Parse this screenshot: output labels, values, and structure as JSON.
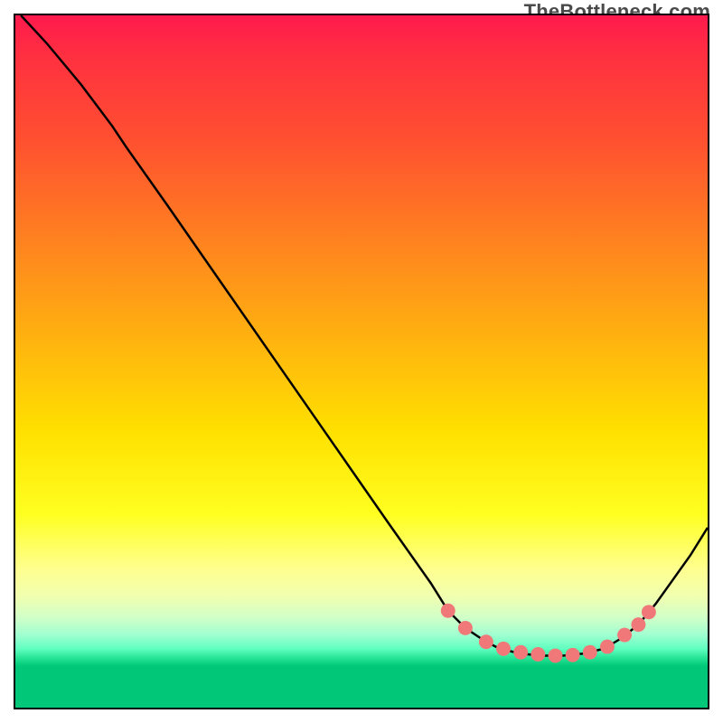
{
  "watermark": "TheBottleneck.com",
  "chart_data": {
    "type": "line",
    "title": "",
    "xlabel": "",
    "ylabel": "",
    "xlim": [
      0,
      100
    ],
    "ylim": [
      0,
      100
    ],
    "background_gradient": {
      "stops": [
        {
          "pos": 0,
          "color": "#ff1a4d"
        },
        {
          "pos": 60,
          "color": "#ffe000"
        },
        {
          "pos": 80,
          "color": "#ffff90"
        },
        {
          "pos": 92,
          "color": "#20e090"
        },
        {
          "pos": 100,
          "color": "#00c878"
        }
      ]
    },
    "series": [
      {
        "name": "curve",
        "type": "line",
        "color": "#000000",
        "points": [
          {
            "x": 0.8,
            "y": 100.0
          },
          {
            "x": 4.5,
            "y": 96.0
          },
          {
            "x": 9.5,
            "y": 90.0
          },
          {
            "x": 14.0,
            "y": 84.0
          },
          {
            "x": 16.0,
            "y": 81.0
          },
          {
            "x": 22.0,
            "y": 72.5
          },
          {
            "x": 30.0,
            "y": 61.0
          },
          {
            "x": 38.0,
            "y": 49.5
          },
          {
            "x": 46.0,
            "y": 38.0
          },
          {
            "x": 54.0,
            "y": 26.5
          },
          {
            "x": 60.0,
            "y": 18.0
          },
          {
            "x": 62.5,
            "y": 14.0
          },
          {
            "x": 65.0,
            "y": 11.5
          },
          {
            "x": 68.0,
            "y": 9.5
          },
          {
            "x": 70.0,
            "y": 8.5
          },
          {
            "x": 73.0,
            "y": 7.8
          },
          {
            "x": 76.0,
            "y": 7.5
          },
          {
            "x": 79.0,
            "y": 7.5
          },
          {
            "x": 82.0,
            "y": 7.8
          },
          {
            "x": 85.0,
            "y": 8.5
          },
          {
            "x": 87.5,
            "y": 10.0
          },
          {
            "x": 90.0,
            "y": 12.0
          },
          {
            "x": 92.5,
            "y": 15.0
          },
          {
            "x": 95.0,
            "y": 18.5
          },
          {
            "x": 97.5,
            "y": 22.0
          },
          {
            "x": 100.0,
            "y": 26.0
          }
        ]
      },
      {
        "name": "dots",
        "type": "scatter",
        "color": "#f07878",
        "radius": 8,
        "points": [
          {
            "x": 62.5,
            "y": 14.0
          },
          {
            "x": 65.0,
            "y": 11.5
          },
          {
            "x": 68.0,
            "y": 9.5
          },
          {
            "x": 70.5,
            "y": 8.5
          },
          {
            "x": 73.0,
            "y": 8.0
          },
          {
            "x": 75.5,
            "y": 7.7
          },
          {
            "x": 78.0,
            "y": 7.5
          },
          {
            "x": 80.5,
            "y": 7.6
          },
          {
            "x": 83.0,
            "y": 8.0
          },
          {
            "x": 85.5,
            "y": 8.8
          },
          {
            "x": 88.0,
            "y": 10.5
          },
          {
            "x": 90.0,
            "y": 12.0
          },
          {
            "x": 91.5,
            "y": 13.8
          }
        ]
      }
    ]
  }
}
